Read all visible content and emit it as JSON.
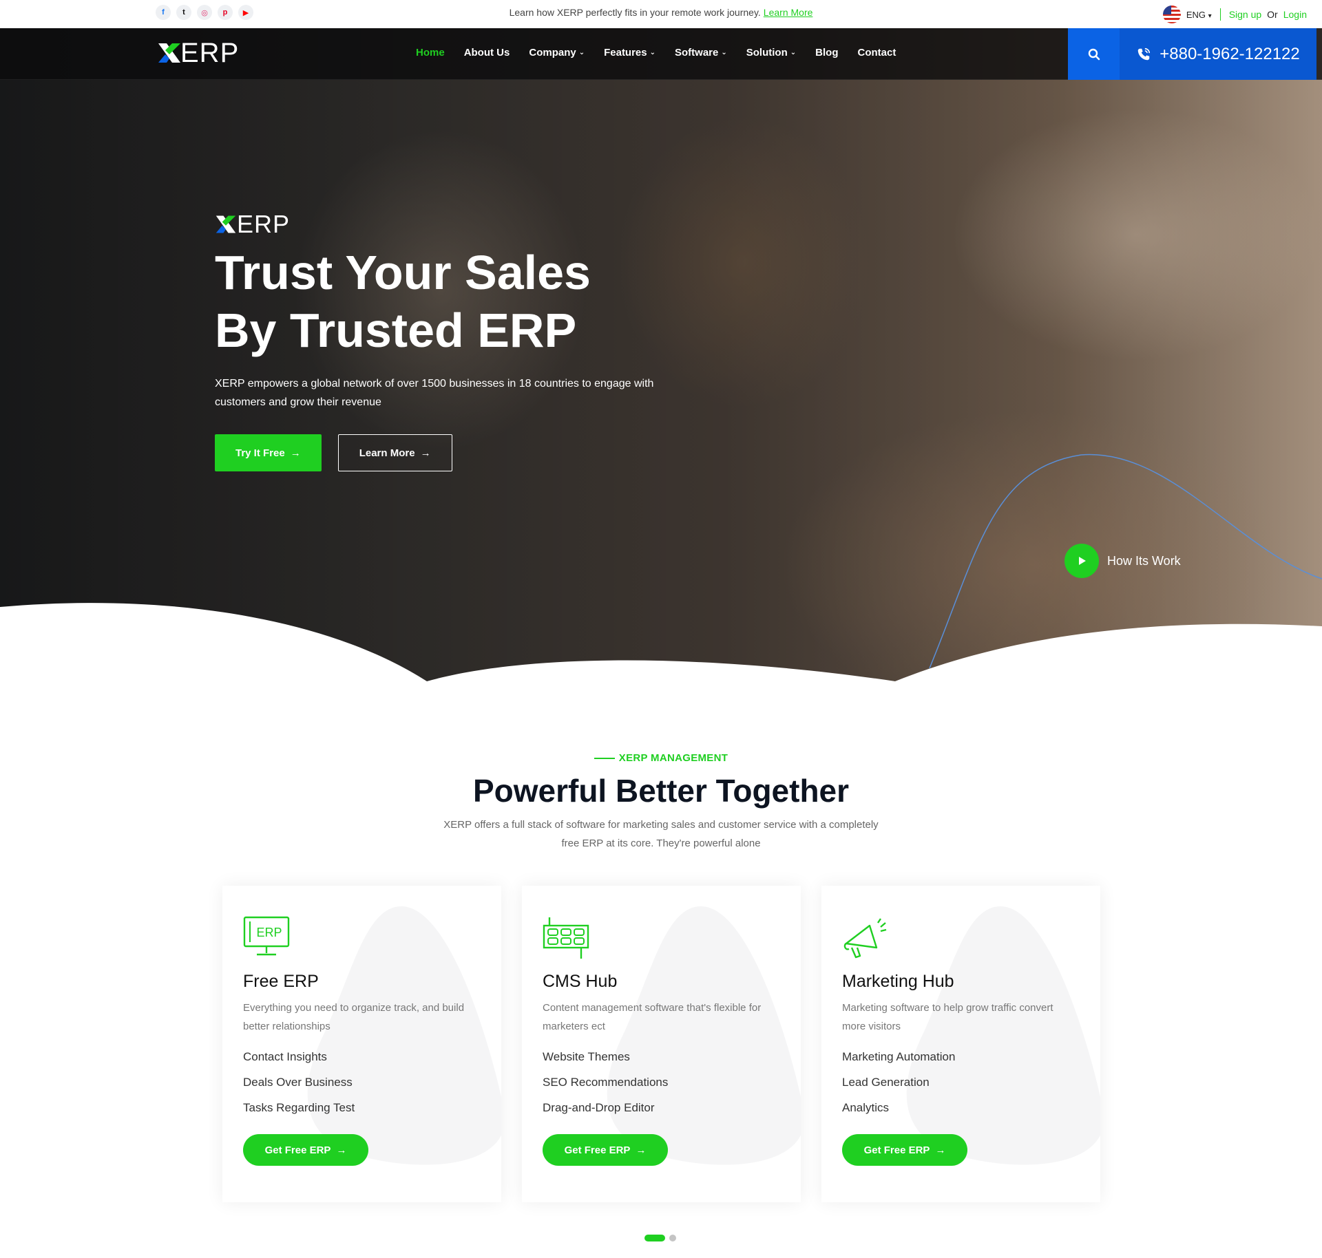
{
  "topbar": {
    "socials": [
      {
        "icon": "facebook-icon",
        "glyph": "f"
      },
      {
        "icon": "twitter-icon",
        "glyph": "t"
      },
      {
        "icon": "instagram-icon",
        "glyph": "◎"
      },
      {
        "icon": "pinterest-icon",
        "glyph": "p"
      },
      {
        "icon": "youtube-icon",
        "glyph": "▶"
      }
    ],
    "announcement": "Learn how XERP perfectly fits in your remote work journey.",
    "announcement_link": "Learn More",
    "language": "ENG",
    "signup": "Sign up",
    "or": "Or",
    "login": "Login"
  },
  "nav": {
    "logo_text": "ERP",
    "items": [
      {
        "label": "Home",
        "dropdown": false
      },
      {
        "label": "About Us",
        "dropdown": false
      },
      {
        "label": "Company",
        "dropdown": true
      },
      {
        "label": "Features",
        "dropdown": true
      },
      {
        "label": "Software",
        "dropdown": true
      },
      {
        "label": "Solution",
        "dropdown": true
      },
      {
        "label": "Blog",
        "dropdown": false
      },
      {
        "label": "Contact",
        "dropdown": false
      }
    ],
    "phone": "+880-1962-122122"
  },
  "hero": {
    "logo_text": "ERP",
    "title_line1": "Trust Your Sales",
    "title_line2": "By Trusted ERP",
    "subtitle": "XERP empowers a global network of over 1500 businesses in 18 countries to engage with customers and grow their revenue",
    "primary_button": "Try It Free",
    "secondary_button": "Learn More",
    "video_button": "How Its Work"
  },
  "features": {
    "eyebrow": "XERP MANAGEMENT",
    "title": "Powerful Better Together",
    "subtitle": "XERP offers a full stack of software for marketing sales and customer service with a completely free ERP at its core. They're powerful alone",
    "cards": [
      {
        "icon": "erp-monitor-icon",
        "icon_text": "ERP",
        "title": "Free ERP",
        "description": "Everything you need to organize track, and build better relationships",
        "items": [
          "Contact Insights",
          "Deals Over Business",
          "Tasks Regarding Test"
        ],
        "button": "Get Free ERP"
      },
      {
        "icon": "cms-grid-icon",
        "title": "CMS Hub",
        "description": "Content management software that's flexible for marketers ect",
        "items": [
          "Website Themes",
          "SEO Recommendations",
          "Drag-and-Drop Editor"
        ],
        "button": "Get Free ERP"
      },
      {
        "icon": "megaphone-icon",
        "title": "Marketing Hub",
        "description": "Marketing software to help grow traffic convert more visitors",
        "items": [
          "Marketing Automation",
          "Lead Generation",
          "Analytics"
        ],
        "button": "Get Free ERP"
      }
    ]
  },
  "carousel": {
    "pages": 2,
    "active_index": 0
  },
  "colors": {
    "accent": "#1fcf21",
    "blue": "#0b63e5",
    "dark": "#0d1421"
  }
}
